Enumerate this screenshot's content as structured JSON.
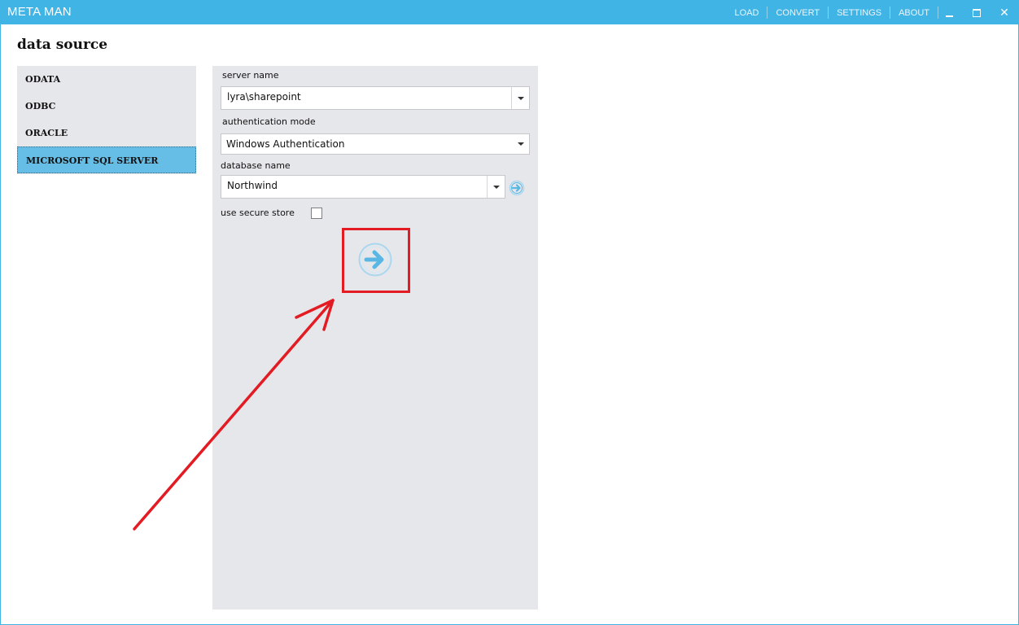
{
  "titlebar": {
    "app_title": "META MAN",
    "menu": [
      "LOAD",
      "CONVERT",
      "SETTINGS",
      "ABOUT"
    ]
  },
  "page": {
    "title": "data source"
  },
  "sidebar": {
    "items": [
      {
        "label": "ODATA",
        "active": false
      },
      {
        "label": "ODBC",
        "active": false
      },
      {
        "label": "ORACLE",
        "active": false
      },
      {
        "label": "MICROSOFT SQL SERVER",
        "active": true
      }
    ]
  },
  "form": {
    "server_name_label": "server name",
    "server_name_value": "lyra\\sharepoint",
    "auth_mode_label": "authentication mode",
    "auth_mode_value": "Windows Authentication",
    "database_label": "database name",
    "database_value": "Northwind",
    "secure_store_label": "use secure store",
    "secure_store_checked": false
  },
  "icons": {
    "connect": "arrow-right-circle-icon",
    "refresh_db": "arrow-right-circle-icon"
  },
  "colors": {
    "titlebar": "#41b4e6",
    "active_item": "#66bde6",
    "annotation": "#e31b23",
    "accent_icon": "#5ab7e3"
  }
}
